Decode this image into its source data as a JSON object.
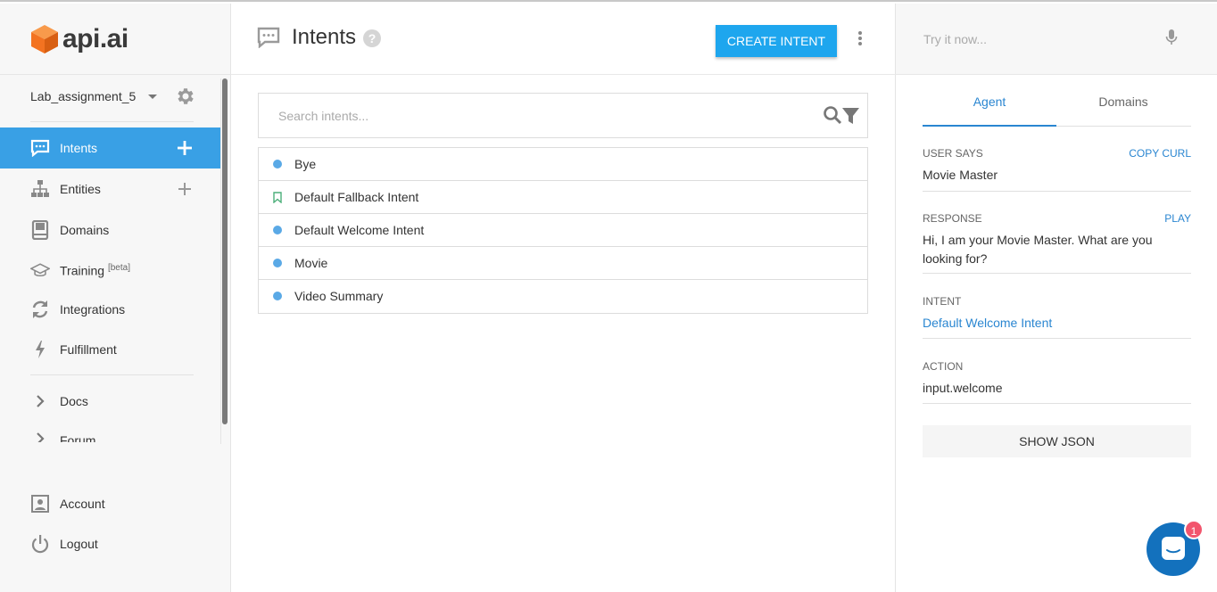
{
  "brand": {
    "name": "api.ai",
    "accent": "#39a0e5",
    "logo_color": "#f37321"
  },
  "sidebar": {
    "agent_name": "Lab_assignment_5",
    "items": [
      {
        "label": "Intents",
        "icon": "chat-bubble-icon",
        "active": true,
        "has_add": true
      },
      {
        "label": "Entities",
        "icon": "hierarchy-icon",
        "has_add": true
      },
      {
        "label": "Domains",
        "icon": "book-icon"
      },
      {
        "label": "Training",
        "sup": "[beta]",
        "icon": "graduation-cap-icon"
      },
      {
        "label": "Integrations",
        "icon": "sync-icon"
      },
      {
        "label": "Fulfillment",
        "icon": "lightning-icon"
      },
      {
        "label": "Docs",
        "icon": "chevron-right-icon"
      },
      {
        "label": "Forum",
        "icon": "chevron-right-icon"
      },
      {
        "label": "Account",
        "icon": "account-icon"
      },
      {
        "label": "Logout",
        "icon": "power-icon"
      }
    ]
  },
  "main": {
    "title": "Intents",
    "create_button": "CREATE INTENT",
    "search_placeholder": "Search intents...",
    "intents": [
      {
        "label": "Bye",
        "marker": "dot"
      },
      {
        "label": "Default Fallback Intent",
        "marker": "bookmark"
      },
      {
        "label": "Default Welcome Intent",
        "marker": "dot"
      },
      {
        "label": "Movie",
        "marker": "dot"
      },
      {
        "label": "Video Summary",
        "marker": "dot"
      }
    ]
  },
  "console": {
    "try_placeholder": "Try it now...",
    "tabs": [
      "Agent",
      "Domains"
    ],
    "user_says_label": "USER SAYS",
    "copy_curl": "COPY CURL",
    "user_says_value": "Movie Master",
    "response_label": "RESPONSE",
    "play": "PLAY",
    "response_value": "Hi, I am your Movie Master. What are you looking for?",
    "intent_label": "INTENT",
    "intent_value": "Default Welcome Intent",
    "action_label": "ACTION",
    "action_value": "input.welcome",
    "show_json": "SHOW JSON",
    "chat_badge": "1"
  }
}
